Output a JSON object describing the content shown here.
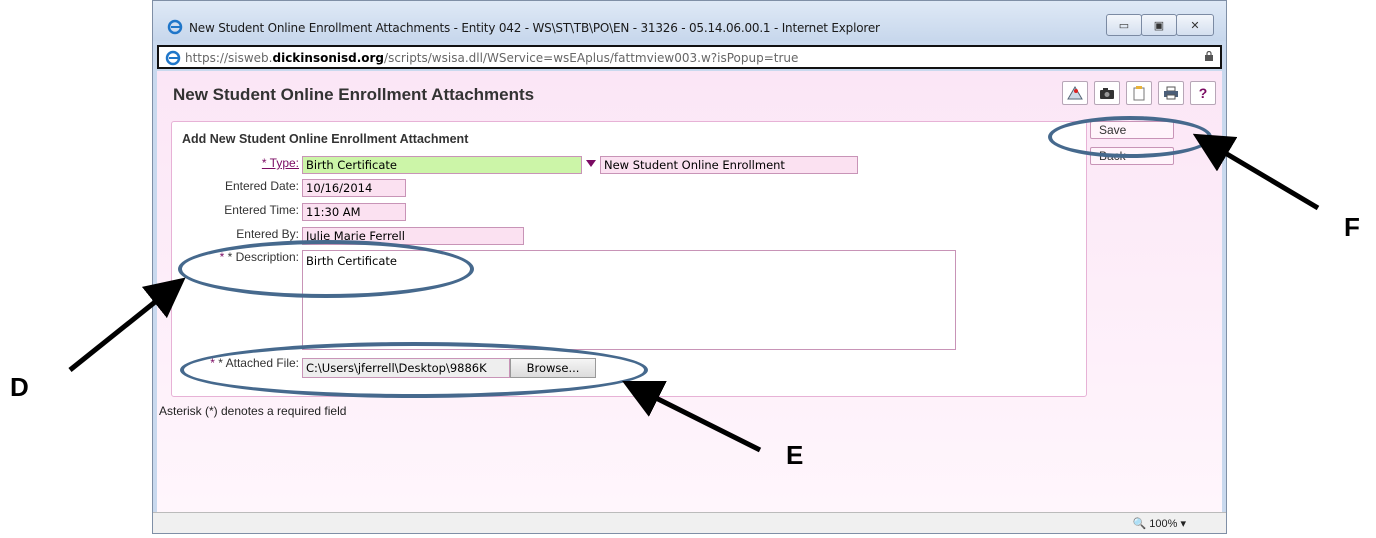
{
  "window": {
    "title": "New Student Online Enrollment Attachments - Entity 042 - WS\\ST\\TB\\PO\\EN - 31326 - 05.14.06.00.1 - Internet Explorer",
    "url_prefix": "https://sisweb.",
    "url_domain": "dickinsonisd.org",
    "url_rest": "/scripts/wsisa.dll/WService=wsEAplus/fattmview003.w?isPopup=true",
    "buttons": [
      "minimize",
      "maximize",
      "close"
    ]
  },
  "page": {
    "title": "New Student Online Enrollment Attachments",
    "toolbar_icons": [
      "map-icon",
      "camera-icon",
      "clipboard-icon",
      "print-icon",
      "help-icon"
    ],
    "help_glyph": "?"
  },
  "form": {
    "title": "Add New Student Online Enrollment Attachment",
    "type_label": "* Type:",
    "type_value": "Birth Certificate",
    "type_group": "New Student Online Enrollment",
    "entered_date_label": "Entered Date:",
    "entered_date": "10/16/2014",
    "entered_time_label": "Entered Time:",
    "entered_time": "11:30 AM",
    "entered_by_label": "Entered By:",
    "entered_by": "Julie Marie Ferrell",
    "description_label": "* Description:",
    "description": "Birth Certificate",
    "attached_label": "* Attached File:",
    "attached_value": "C:\\Users\\jferrell\\Desktop\\9886K",
    "browse_label": "Browse...",
    "save_label": "Save",
    "back_label": "Back",
    "note": "Asterisk (*) denotes a required field"
  },
  "status": {
    "zoom": "100%"
  },
  "annotations": {
    "d": "D",
    "e": "E",
    "f": "F"
  }
}
